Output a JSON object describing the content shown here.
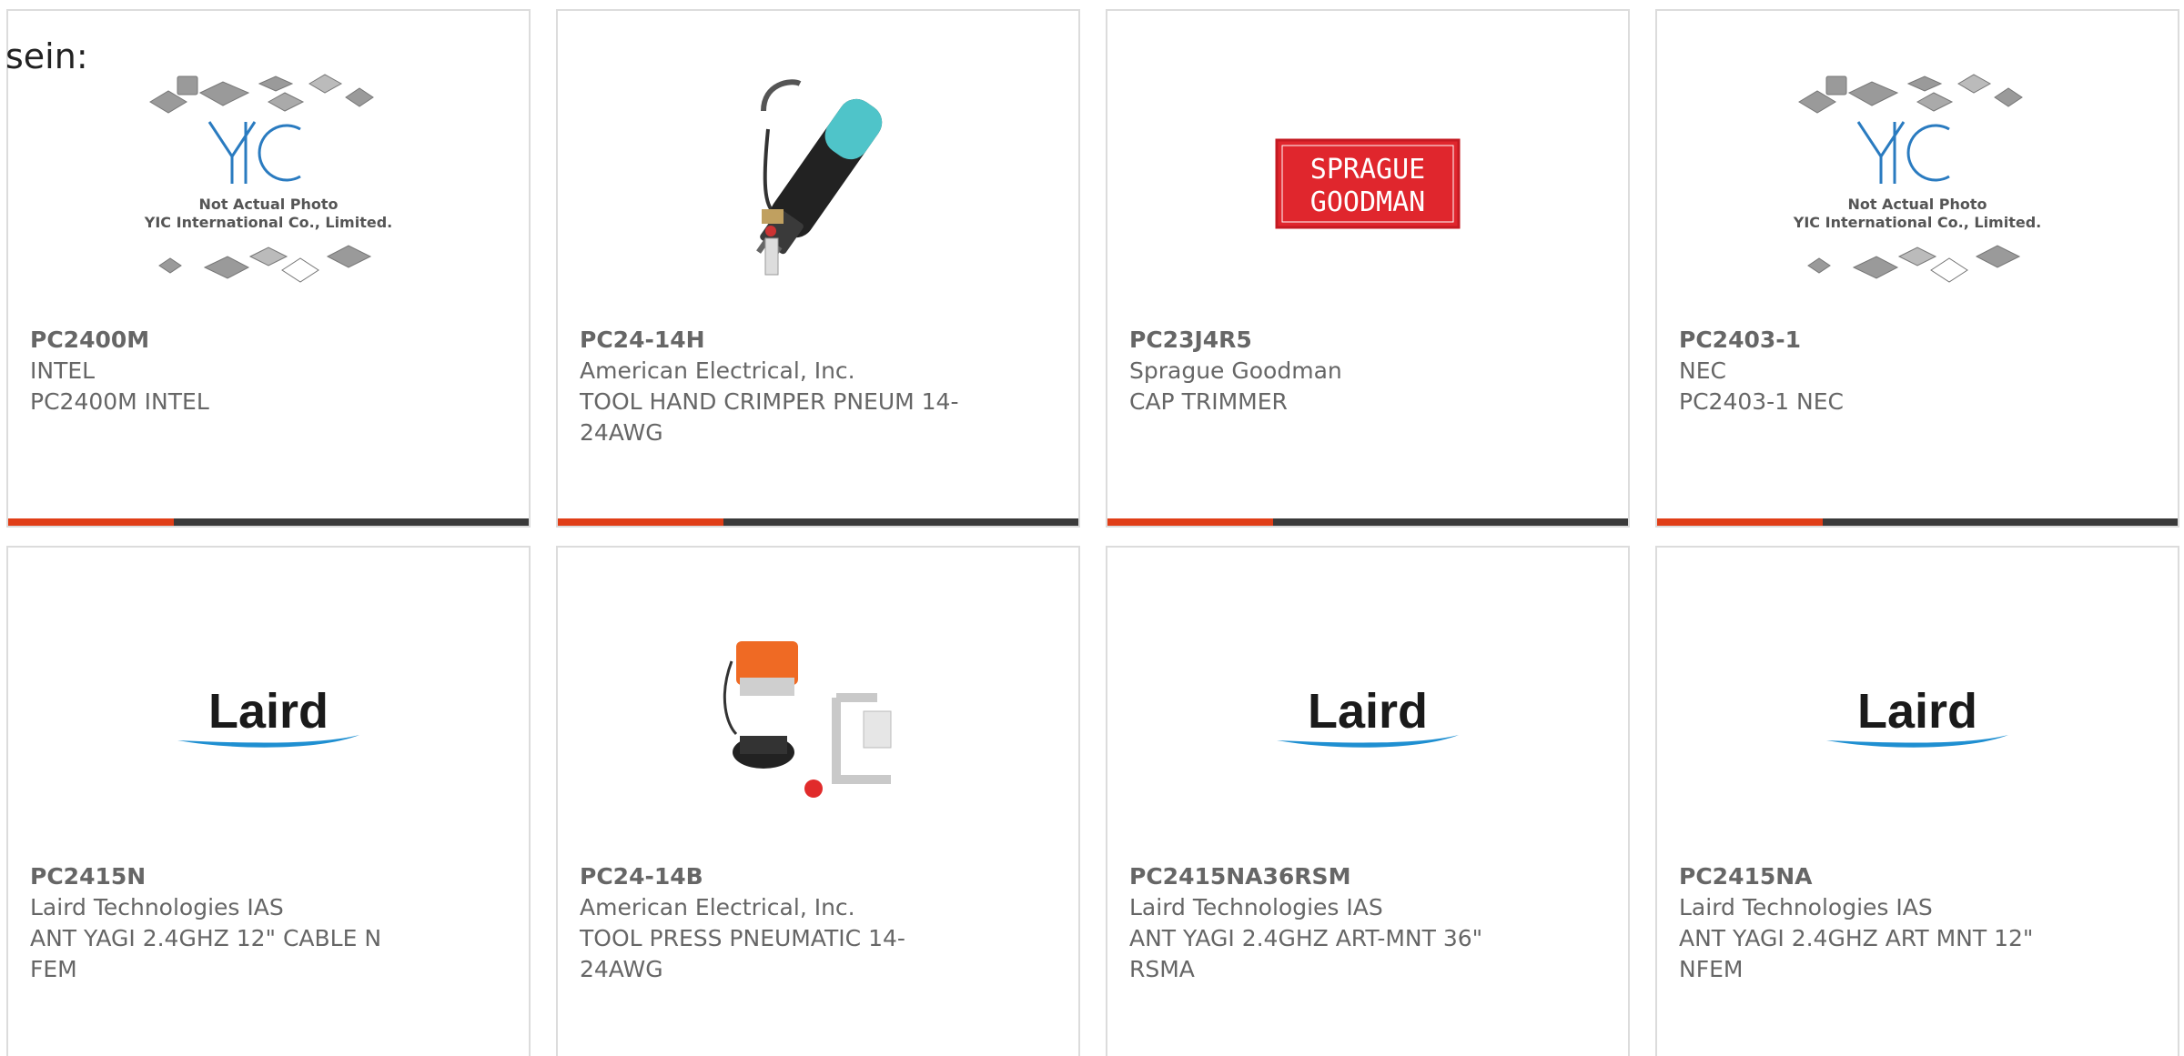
{
  "page": {
    "heading": "sein:"
  },
  "colors": {
    "accent_bar": "#e03e17",
    "bar_dark": "#3a3a3a",
    "text_gray": "#666666",
    "card_border": "#dcdcdc"
  },
  "yic_image": {
    "line1": "Not Actual Photo",
    "line2": "YIC International Co., Limited."
  },
  "logos": {
    "laird": "Laird",
    "sprague_line1": "SPRAGUE",
    "sprague_line2": "GOODMAN"
  },
  "cards": [
    {
      "image": "yic-placeholder-image",
      "part_number": "PC2400M",
      "manufacturer": "INTEL",
      "description": "PC2400M INTEL"
    },
    {
      "image": "crimper-tool-image",
      "part_number": "PC24-14H",
      "manufacturer": "American Electrical, Inc.",
      "description": "TOOL HAND CRIMPER PNEUM 14-24AWG"
    },
    {
      "image": "sprague-goodman-logo",
      "part_number": "PC23J4R5",
      "manufacturer": "Sprague Goodman",
      "description": "CAP TRIMMER"
    },
    {
      "image": "yic-placeholder-image",
      "part_number": "PC2403-1",
      "manufacturer": "NEC",
      "description": "PC2403-1 NEC"
    },
    {
      "image": "laird-logo",
      "part_number": "PC2415N",
      "manufacturer": "Laird Technologies IAS",
      "description": "ANT YAGI 2.4GHZ 12\" CABLE N FEM"
    },
    {
      "image": "pneumatic-press-image",
      "part_number": "PC24-14B",
      "manufacturer": "American Electrical, Inc.",
      "description": "TOOL PRESS PNEUMATIC 14-24AWG"
    },
    {
      "image": "laird-logo",
      "part_number": "PC2415NA36RSM",
      "manufacturer": "Laird Technologies IAS",
      "description": "ANT YAGI 2.4GHZ ART-MNT 36\" RSMA"
    },
    {
      "image": "laird-logo",
      "part_number": "PC2415NA",
      "manufacturer": "Laird Technologies IAS",
      "description": "ANT YAGI 2.4GHZ ART MNT 12\" NFEM"
    }
  ]
}
